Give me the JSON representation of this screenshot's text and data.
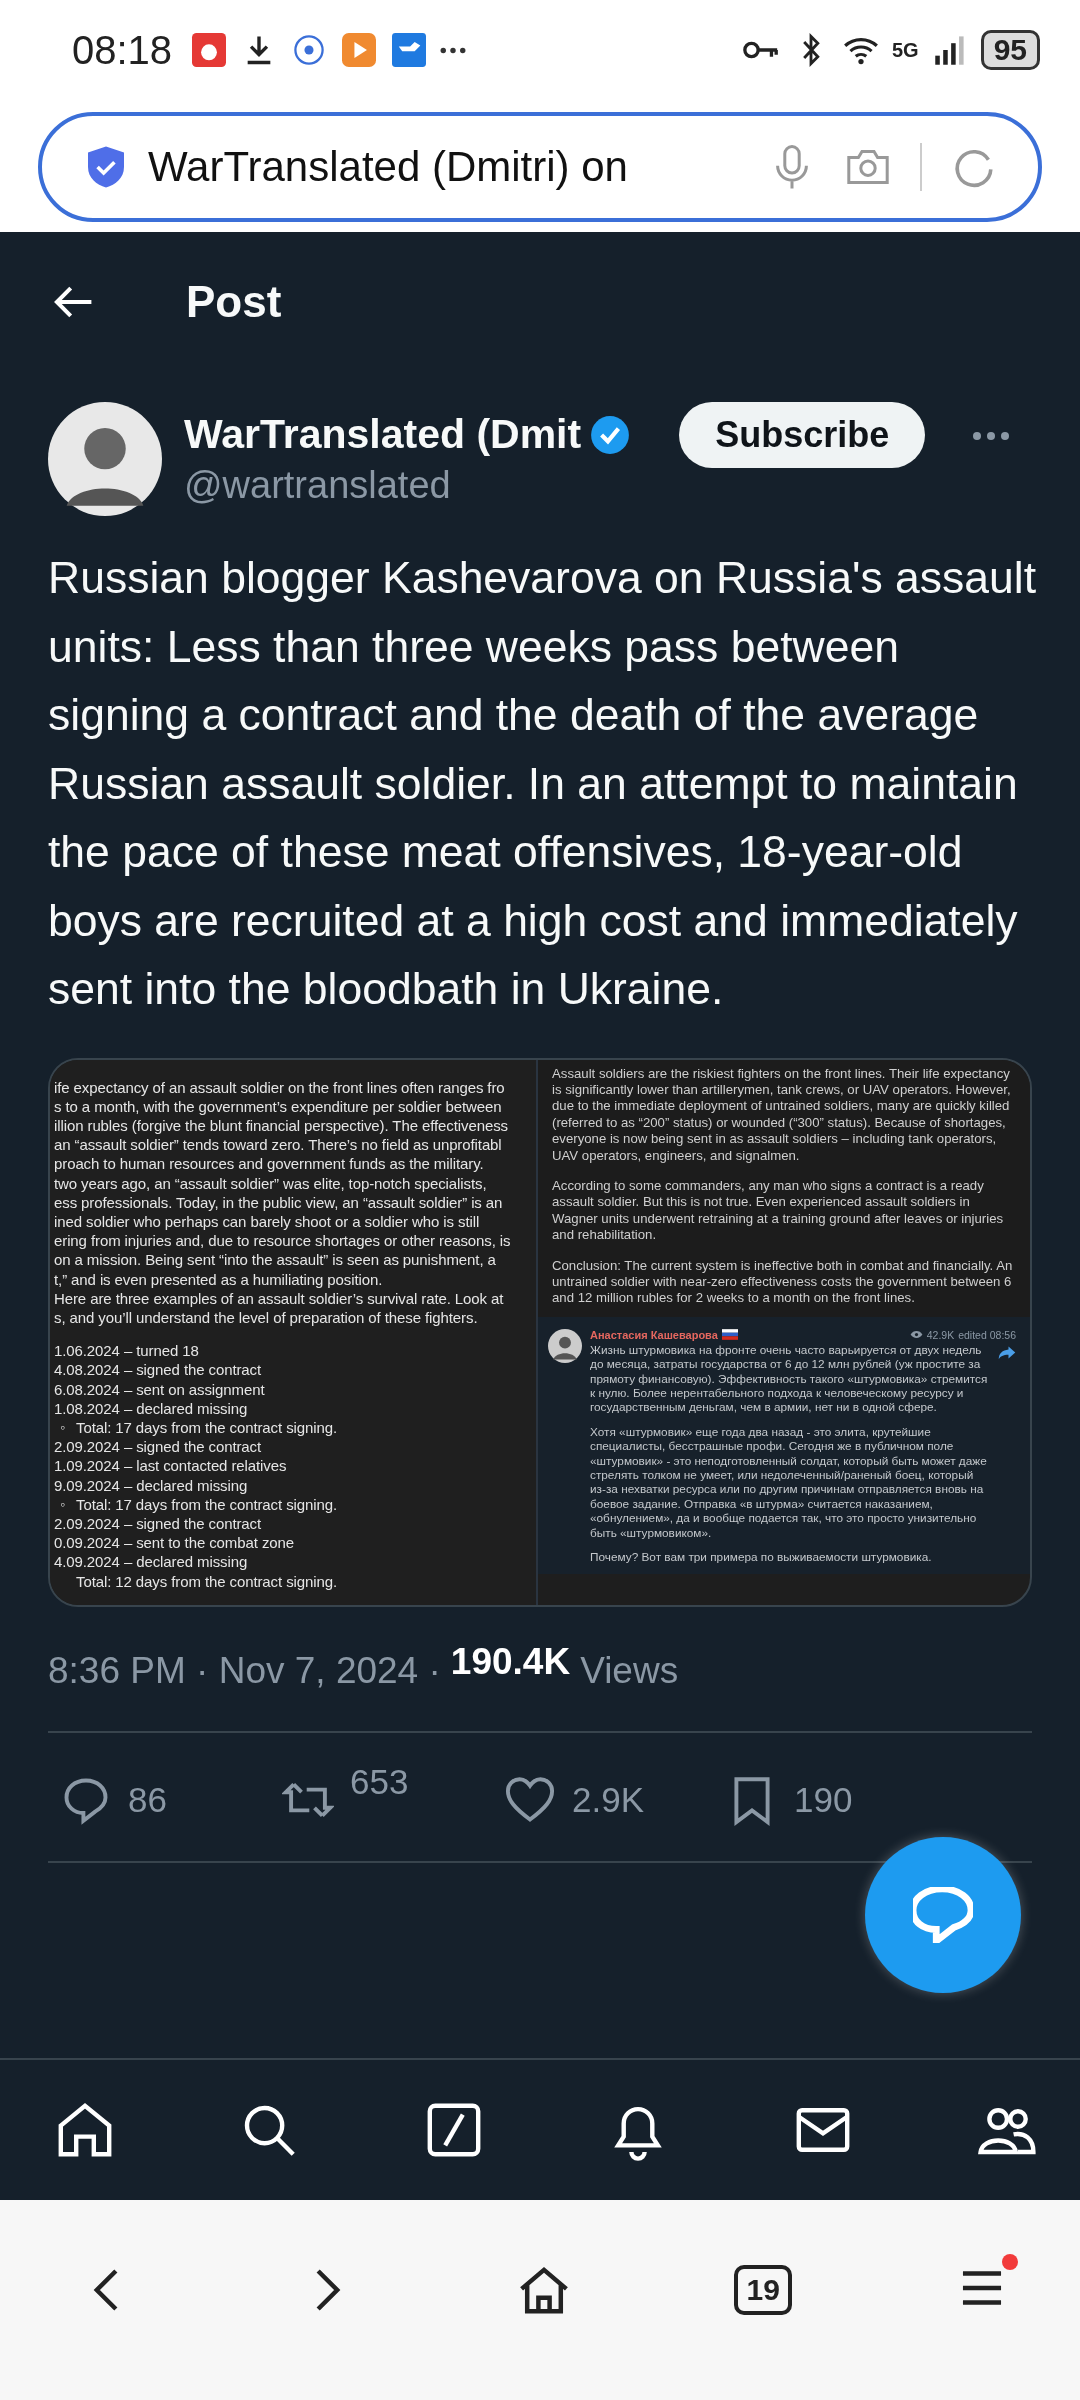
{
  "status_bar": {
    "time": "08:18",
    "network": "5G",
    "battery": "95"
  },
  "address_bar": {
    "value": "WarTranslated (Dmitri) on"
  },
  "header": {
    "title": "Post"
  },
  "author": {
    "name": "WarTranslated (Dmit",
    "verified": true,
    "handle": "@wartranslated",
    "subscribe_label": "Subscribe"
  },
  "post": {
    "text": "Russian blogger Kashevarova on Russia's assault units: Less than three weeks pass between signing a contract and the death of the average Russian assault soldier. In an attempt to maintain the pace of these meat offensives, 18-year-old boys are recruited at a high cost and immediately sent into the bloodbath in Ukraine."
  },
  "attachment": {
    "left_lines": [
      "ife expectancy of an assault soldier on the front lines often ranges fro",
      "s to a month, with the government’s expenditure per soldier between",
      "illion rubles (forgive the blunt financial perspective). The effectiveness",
      "an “assault soldier” tends toward zero. There’s no field as unprofitabl",
      "proach to human resources and government funds as the military.",
      "two years ago, an “assault soldier” was elite, top-notch specialists,",
      "ess professionals. Today, in the public view, an “assault soldier” is an",
      "ined soldier who perhaps can barely shoot or a soldier who is still",
      "ering from injuries and, due to resource shortages or other reasons, is",
      "on a mission. Being sent “into the assault” is seen as punishment, a",
      "t,” and is even presented as a humiliating position.",
      "Here are three examples of an assault soldier’s survival rate. Look at",
      "s, and you’ll understand the level of preparation of these fighters."
    ],
    "timeline": [
      {
        "kind": "line",
        "text": "1.06.2024 – turned 18"
      },
      {
        "kind": "line",
        "text": "4.08.2024 – signed the contract"
      },
      {
        "kind": "line",
        "text": "6.08.2024 – sent on assignment"
      },
      {
        "kind": "line",
        "text": "1.08.2024 – declared missing"
      },
      {
        "kind": "sub",
        "marker": "◦",
        "text": "Total: 17 days from the contract signing."
      },
      {
        "kind": "line",
        "text": "2.09.2024 – signed the contract"
      },
      {
        "kind": "line",
        "text": "1.09.2024 – last contacted relatives"
      },
      {
        "kind": "line",
        "text": "9.09.2024 – declared missing"
      },
      {
        "kind": "sub",
        "marker": "◦",
        "text": "Total: 17 days from the contract signing."
      },
      {
        "kind": "line",
        "text": "2.09.2024 – signed the contract"
      },
      {
        "kind": "line",
        "text": "0.09.2024 – sent to the combat zone"
      },
      {
        "kind": "line",
        "text": "4.09.2024 – declared missing"
      },
      {
        "kind": "sub",
        "text": "Total: 12 days from the contract signing."
      }
    ],
    "right_paragraphs": [
      "Assault soldiers are the riskiest fighters on the front lines. Their life expectancy is significantly lower than artillerymen, tank crews, or UAV operators. However, due to the immediate deployment of untrained soldiers, many are quickly killed (referred to as “200” status) or wounded (“300” status). Because of shortages, everyone is now being sent in as assault soldiers – including tank operators, UAV operators, engineers, and signalmen.",
      "According to some commanders, any man who signs a contract is a ready assault soldier. But this is not true. Even experienced assault soldiers in Wagner units underwent retraining at a training ground after leaves or injuries and rehabilitation.",
      "Conclusion: The current system is ineffective both in combat and financially. An untrained soldier with near-zero effectiveness costs the government between 6 and 12 million rubles for 2 weeks to a month on the front lines."
    ],
    "channel_post": {
      "author": "Анастасия Кашеварова",
      "views": "42.9K",
      "edited": "edited 08:56",
      "paragraphs": [
        "Жизнь штурмовика на фронте очень часто варьируется от двух недель до месяца, затраты государства от 6 до 12 млн рублей (уж простите за прямоту финансовую). Эффективность такого «штурмовика» стремится к нулю. Более нерентабельного подхода к человеческому ресурсу и государственным деньгам, чем в армии, нет ни в одной сфере.",
        "Хотя «штурмовик» еще года два назад - это элита, крутейшие специалисты, бесстрашные профи. Сегодня же в публичном поле «штурмовик» - это неподготовленный солдат, который быть может даже стрелять толком не умеет, или недолеченный/раненый боец, который из-за нехватки ресурса или по другим причинам отправляется вновь на боевое задание. Отправка «в штурма» считается наказанием, «обнулением», да и вообще подается так, что это просто унизительно быть «штурмовиком».",
        "Почему? Вот вам три примера по выживаемости штурмовика."
      ]
    }
  },
  "meta": {
    "time": "8:36 PM · Nov 7, 2024 ·",
    "views_count": "190.4K",
    "views_label": "Views"
  },
  "actions": [
    {
      "kind": "reply",
      "count": "86"
    },
    {
      "kind": "repost",
      "count": "653"
    },
    {
      "kind": "like",
      "count": "2.9K"
    },
    {
      "kind": "bookmark",
      "count": "190"
    }
  ],
  "bottom_nav": [
    {
      "kind": "home"
    },
    {
      "kind": "search"
    },
    {
      "kind": "grok"
    },
    {
      "kind": "notifications"
    },
    {
      "kind": "messages"
    },
    {
      "kind": "communities"
    }
  ],
  "browser_nav": {
    "tabs_count": "19",
    "menu_badge": true
  }
}
